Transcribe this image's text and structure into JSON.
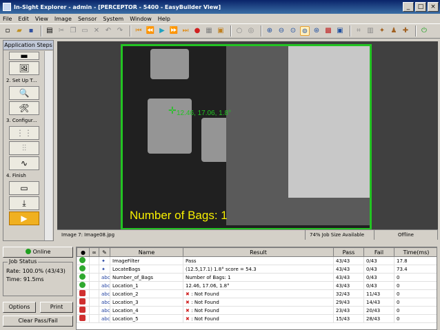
{
  "window": {
    "title": "In-Sight Explorer - admin - [PERCEPTOR - 5400 - EasyBuilder View]"
  },
  "menu": [
    "File",
    "Edit",
    "View",
    "Image",
    "Sensor",
    "System",
    "Window",
    "Help"
  ],
  "left": {
    "header": "Application Steps",
    "steps": [
      "2. Set Up T...",
      "3. Configur...",
      "4. Finish"
    ]
  },
  "viewer": {
    "overlay_count": "Number of Bags:  1",
    "overlay_coords": "12.46, 17.06, 1.8°",
    "status_image": "Image 7: Image08.jpg",
    "status_job": "74% Job Size Available",
    "status_mode": "Offline"
  },
  "controls": {
    "online": "Online",
    "job_status_title": "Job Status",
    "rate": "Rate: 100.0% (43/43)",
    "time": "Time: 91.5ms",
    "options": "Options",
    "print": "Print",
    "clear": "Clear Pass/Fail"
  },
  "results": {
    "columns": [
      "Name",
      "Result",
      "Pass",
      "Fail",
      "Time(ms)"
    ],
    "rows": [
      {
        "status": "pass",
        "name": "ImageFilter",
        "result": "Pass",
        "pass": "43/43",
        "fail": "0/43",
        "time": "17.8"
      },
      {
        "status": "pass",
        "name": "LocateBags",
        "result": "(12.5,17.1) 1.8° score = 54.3",
        "pass": "43/43",
        "fail": "0/43",
        "time": "73.4"
      },
      {
        "status": "pass",
        "name": "Number_of_Bags",
        "result": "Number of Bags:  1",
        "pass": "43/43",
        "fail": "0/43",
        "time": "0"
      },
      {
        "status": "pass",
        "name": "Location_1",
        "result": "12.46, 17.06, 1.8°",
        "pass": "43/43",
        "fail": "0/43",
        "time": "0"
      },
      {
        "status": "fail",
        "name": "Location_2",
        "result": ": Not Found",
        "pass": "32/43",
        "fail": "11/43",
        "time": "0"
      },
      {
        "status": "fail",
        "name": "Location_3",
        "result": ": Not Found",
        "pass": "29/43",
        "fail": "14/43",
        "time": "0"
      },
      {
        "status": "fail",
        "name": "Location_4",
        "result": ": Not Found",
        "pass": "23/43",
        "fail": "20/43",
        "time": "0"
      },
      {
        "status": "fail",
        "name": "Location_5",
        "result": ": Not Found",
        "pass": "15/43",
        "fail": "28/43",
        "time": "0"
      }
    ]
  },
  "colors": {
    "overlay_green": "#22c422",
    "overlay_yellow": "#f8f000",
    "pass": "#2ea82e",
    "fail": "#d03030"
  }
}
